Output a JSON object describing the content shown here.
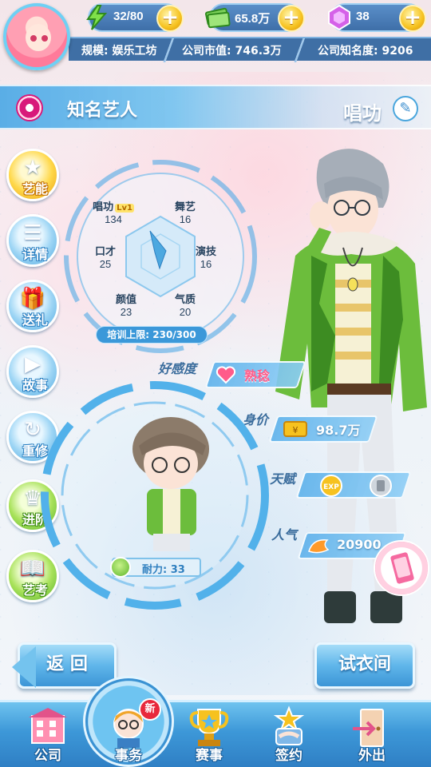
{
  "resources": {
    "energy": "32/80",
    "money": "65.8万",
    "gems": "38"
  },
  "info_strip": {
    "scale": "规模: 娱乐工坊",
    "market_value": "公司市值: 746.3万",
    "fame": "公司知名度: 9206"
  },
  "header": {
    "title": "知名艺人",
    "skill": "唱功"
  },
  "side_menu": [
    {
      "label": "艺能"
    },
    {
      "label": "详情"
    },
    {
      "label": "送礼"
    },
    {
      "label": "故事"
    },
    {
      "label": "重修"
    },
    {
      "label": "进阶"
    },
    {
      "label": "艺考"
    }
  ],
  "stats": {
    "singing": {
      "name": "唱功",
      "level": "Lv1",
      "value": "134"
    },
    "dance": {
      "name": "舞艺",
      "value": "16"
    },
    "eloquence": {
      "name": "口才",
      "value": "25"
    },
    "acting": {
      "name": "演技",
      "value": "16"
    },
    "looks": {
      "name": "颜值",
      "value": "23"
    },
    "temperament": {
      "name": "气质",
      "value": "20"
    },
    "train_limit": "培训上限: 230/300"
  },
  "profile": {
    "affection_label": "好感度",
    "affection_value": "熟稔",
    "price_label": "身价",
    "price_value": "98.7万",
    "talent_label": "天赋",
    "popularity_label": "人气",
    "popularity_value": "20900"
  },
  "stamina": "耐力: 33",
  "buttons": {
    "back": "返 回",
    "wardrobe": "试衣间"
  },
  "bottom_nav": [
    {
      "label": "公司"
    },
    {
      "label": "事务",
      "badge": "新"
    },
    {
      "label": "赛事"
    },
    {
      "label": "签约"
    },
    {
      "label": "外出"
    }
  ],
  "colors": {
    "accent": "#3d98d8",
    "gold": "#f6c21f",
    "heart": "#ff5c8a"
  }
}
